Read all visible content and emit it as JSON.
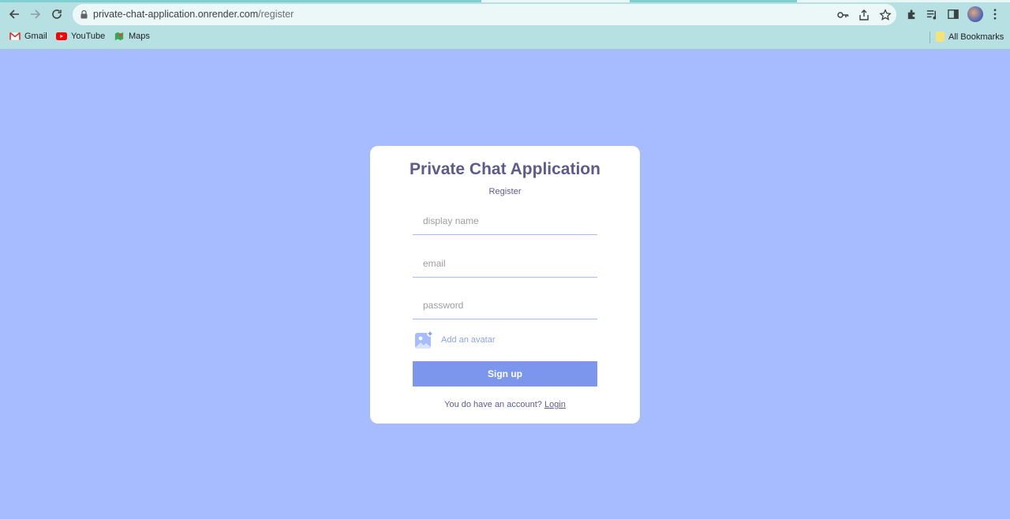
{
  "browser": {
    "url_host": "private-chat-application.onrender.com",
    "url_path": "/register",
    "bookmarks": [
      {
        "label": "Gmail",
        "icon": "gmail-icon"
      },
      {
        "label": "YouTube",
        "icon": "youtube-icon"
      },
      {
        "label": "Maps",
        "icon": "maps-icon"
      }
    ],
    "all_bookmarks_label": "All Bookmarks"
  },
  "form": {
    "title": "Private Chat Application",
    "subtitle": "Register",
    "display_name_placeholder": "display name",
    "email_placeholder": "email",
    "password_placeholder": "password",
    "avatar_label": "Add an avatar",
    "submit_label": "Sign up",
    "footer_text": "You do have an account?",
    "login_link": "Login"
  },
  "colors": {
    "page_bg": "#a7bcff",
    "accent": "#7b96ec",
    "title": "#5d5b8d"
  }
}
